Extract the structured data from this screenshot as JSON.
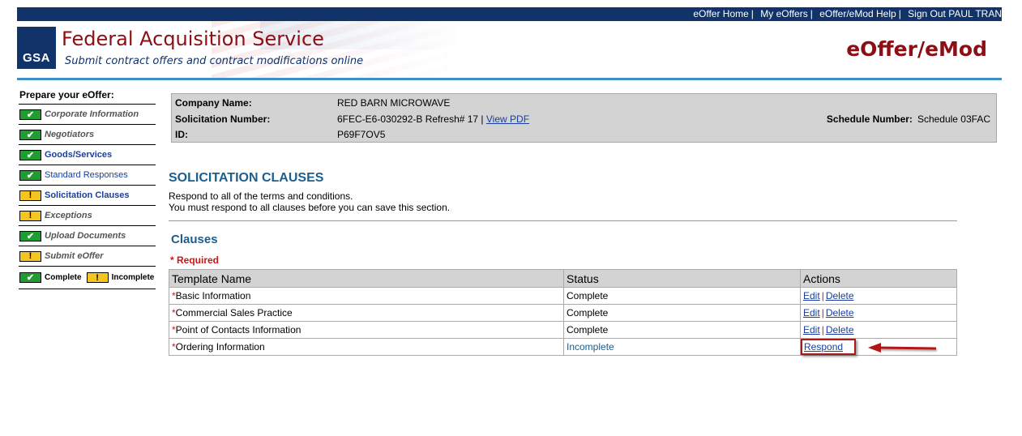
{
  "topnav": {
    "home": "eOffer Home",
    "my_eoffers": "My eOffers",
    "help": "eOffer/eMod Help",
    "signout": "Sign Out PAUL TRAN",
    "separator": "|"
  },
  "header": {
    "logo_text": "GSA",
    "title": "Federal Acquisition Service",
    "subtitle": "Submit contract offers and contract modifications online",
    "app_name": "eOffer/eMod",
    "colors": {
      "navy": "#11336a",
      "maroon": "#8b0f14",
      "accent_line": "#3e8fc4"
    }
  },
  "sidebar": {
    "heading": "Prepare your eOffer:",
    "items": [
      {
        "label": "Corporate Information",
        "state": "complete",
        "style": "dim",
        "icon": "check-icon"
      },
      {
        "label": "Negotiators",
        "state": "complete",
        "style": "dim",
        "icon": "check-icon"
      },
      {
        "label": "Goods/Services",
        "state": "complete",
        "style": "active",
        "icon": "check-icon"
      },
      {
        "label": "Standard Responses",
        "state": "complete",
        "style": "link",
        "icon": "check-icon"
      },
      {
        "label": "Solicitation Clauses",
        "state": "incomplete",
        "style": "active",
        "icon": "exclamation-icon"
      },
      {
        "label": "Exceptions",
        "state": "incomplete",
        "style": "dim",
        "icon": "exclamation-icon"
      },
      {
        "label": "Upload Documents",
        "state": "complete",
        "style": "dim",
        "icon": "check-icon"
      },
      {
        "label": "Submit eOffer",
        "state": "incomplete",
        "style": "dim",
        "icon": "exclamation-icon"
      }
    ],
    "legend": {
      "complete": "Complete",
      "incomplete": "Incomplete"
    },
    "status_colors": {
      "complete": "#1e9e2e",
      "incomplete": "#f4c51f"
    }
  },
  "info": {
    "company_label": "Company Name:",
    "company_value": "RED BARN MICROWAVE",
    "solicitation_label": "Solicitation Number:",
    "solicitation_value": "6FEC-E6-030292-B Refresh# 17 |",
    "view_pdf": "View PDF",
    "id_label": "ID:",
    "id_value": "P69F7OV5",
    "schedule_label": "Schedule Number:",
    "schedule_value": "Schedule 03FAC"
  },
  "section": {
    "title": "SOLICITATION CLAUSES",
    "desc_line1": "Respond to all of the terms and conditions.",
    "desc_line2": "You must respond to all clauses before you can save this section.",
    "clauses_title": "Clauses",
    "required_note": "* Required"
  },
  "table": {
    "headers": {
      "name": "Template Name",
      "status": "Status",
      "actions": "Actions"
    },
    "rows": [
      {
        "name": "Basic Information",
        "status": "Complete",
        "edit": "Edit",
        "delete": "Delete"
      },
      {
        "name": "Commercial Sales Practice",
        "status": "Complete",
        "edit": "Edit",
        "delete": "Delete"
      },
      {
        "name": "Point of Contacts Information",
        "status": "Complete",
        "edit": "Edit",
        "delete": "Delete"
      },
      {
        "name": "Ordering Information",
        "status": "Incomplete",
        "respond": "Respond"
      }
    ],
    "required_marker": "*",
    "action_separator": "|"
  }
}
